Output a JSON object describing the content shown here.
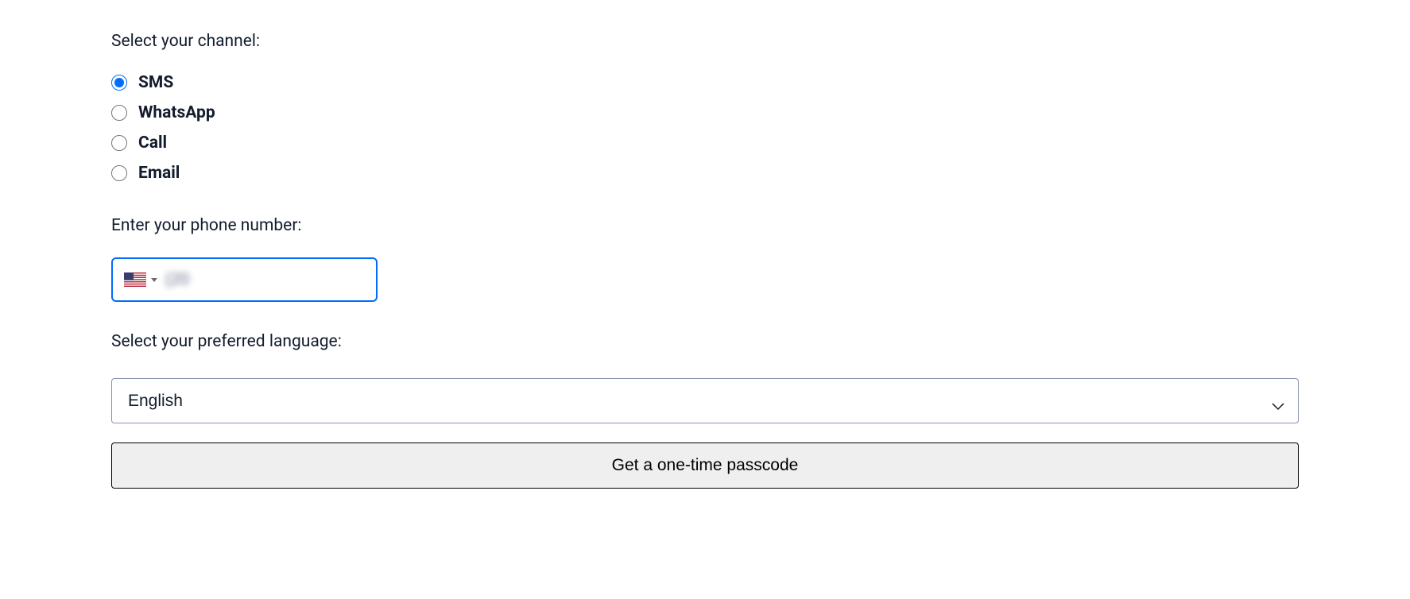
{
  "labels": {
    "channel": "Select your channel:",
    "phone": "Enter your phone number:",
    "language": "Select your preferred language:"
  },
  "channels": [
    {
      "id": "sms",
      "label": "SMS",
      "selected": true
    },
    {
      "id": "whatsapp",
      "label": "WhatsApp",
      "selected": false
    },
    {
      "id": "call",
      "label": "Call",
      "selected": false
    },
    {
      "id": "email",
      "label": "Email",
      "selected": false
    }
  ],
  "phone": {
    "country": "US",
    "value": "(20"
  },
  "language": {
    "selected": "English"
  },
  "button": {
    "submit": "Get a one-time passcode"
  }
}
